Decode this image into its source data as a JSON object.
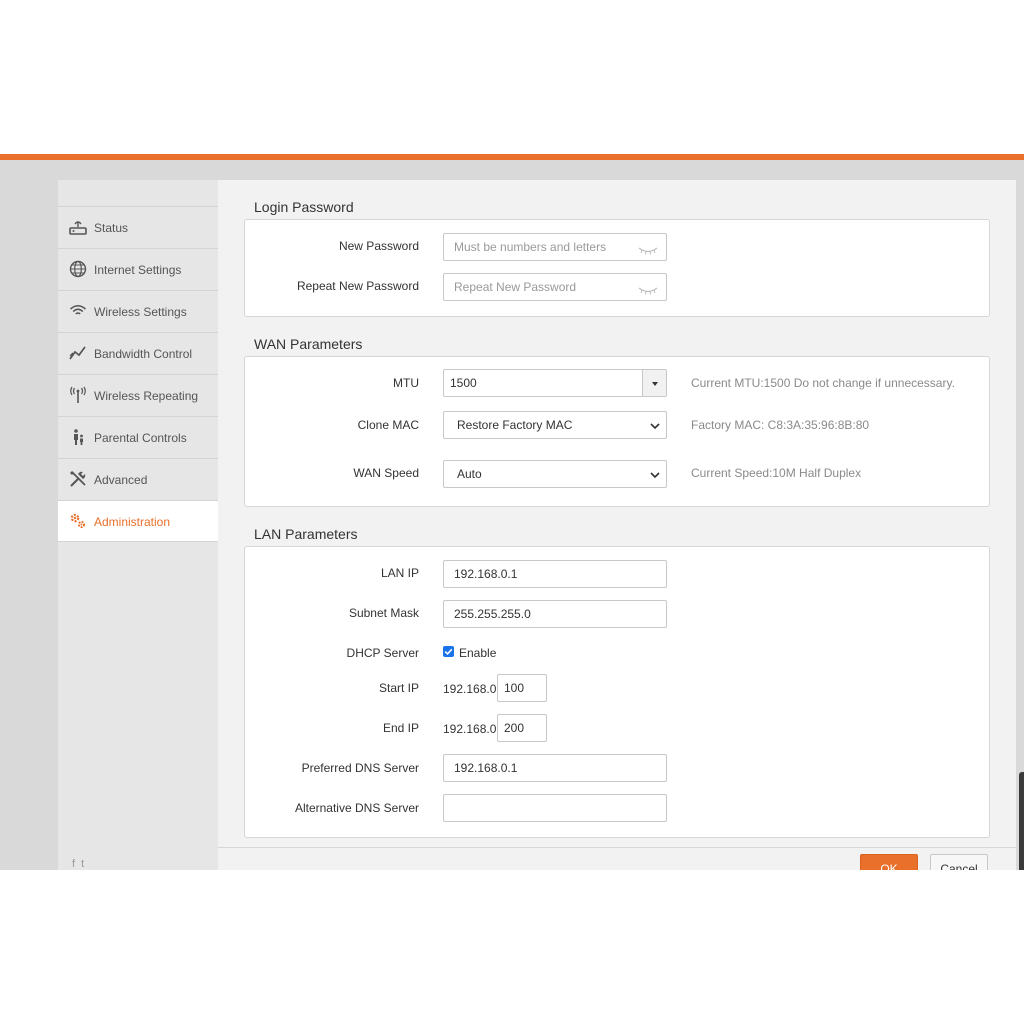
{
  "sidebar": {
    "items": [
      {
        "label": "Status",
        "icon": "router-icon"
      },
      {
        "label": "Internet Settings",
        "icon": "globe-icon"
      },
      {
        "label": "Wireless Settings",
        "icon": "wifi-icon"
      },
      {
        "label": "Bandwidth Control",
        "icon": "chart-line-icon"
      },
      {
        "label": "Wireless Repeating",
        "icon": "antenna-icon"
      },
      {
        "label": "Parental Controls",
        "icon": "family-icon"
      },
      {
        "label": "Advanced",
        "icon": "tools-icon"
      },
      {
        "label": "Administration",
        "icon": "gears-icon"
      }
    ],
    "active": "Administration",
    "social": {
      "facebook": "f",
      "twitter": "t"
    }
  },
  "login": {
    "title": "Login Password",
    "new_password_label": "New Password",
    "new_password_placeholder": "Must be numbers and letters",
    "repeat_label": "Repeat New Password",
    "repeat_placeholder": "Repeat New Password"
  },
  "wan": {
    "title": "WAN Parameters",
    "mtu_label": "MTU",
    "mtu_value": "1500",
    "mtu_hint": "Current MTU:1500 Do not change if unnecessary.",
    "clone_label": "Clone MAC",
    "clone_value": "Restore Factory MAC",
    "clone_hint": "Factory MAC: C8:3A:35:96:8B:80",
    "speed_label": "WAN Speed",
    "speed_value": "Auto",
    "speed_hint": "Current Speed:10M Half Duplex"
  },
  "lan": {
    "title": "LAN Parameters",
    "lan_ip_label": "LAN IP",
    "lan_ip_value": "192.168.0.1",
    "mask_label": "Subnet Mask",
    "mask_value": "255.255.255.0",
    "dhcp_label": "DHCP Server",
    "dhcp_enable_label": "Enable",
    "dhcp_enabled": true,
    "start_label": "Start IP",
    "start_prefix": "192.168.0.",
    "start_value": "100",
    "end_label": "End IP",
    "end_prefix": "192.168.0.",
    "end_value": "200",
    "pref_dns_label": "Preferred DNS Server",
    "pref_dns_value": "192.168.0.1",
    "alt_dns_label": "Alternative DNS Server",
    "alt_dns_value": ""
  },
  "actions": {
    "ok_label": "OK",
    "cancel_label": "Cancel"
  },
  "colors": {
    "accent": "#e8702a",
    "checkbox": "#1a73e8"
  }
}
